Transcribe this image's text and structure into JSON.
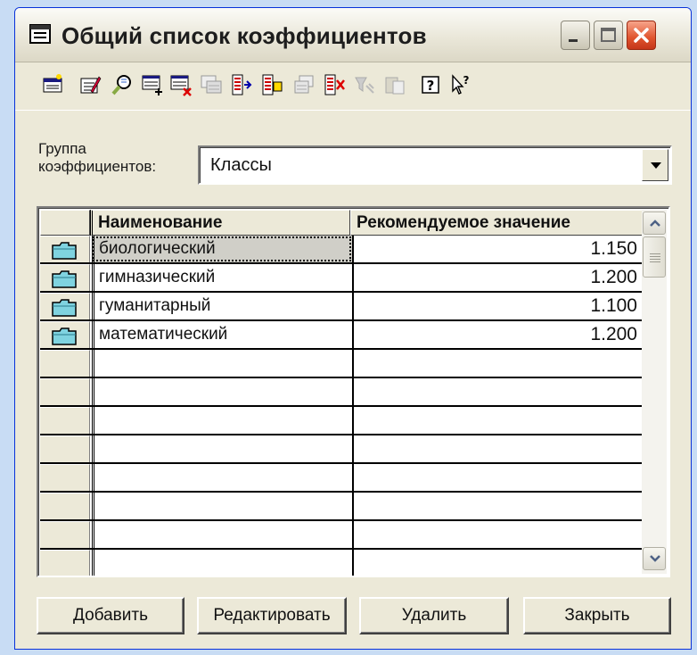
{
  "window": {
    "title": "Общий список коэффициентов",
    "controls": {
      "minimize": "minimize",
      "maximize": "maximize",
      "close": "close"
    }
  },
  "toolbar": {
    "icons": [
      "add-record-icon",
      "edit-record-icon",
      "search-icon",
      "insert-row-icon",
      "delete-row-icon",
      "copy-record-icon",
      "move-right-icon",
      "export-icon",
      "duplicate-icon",
      "remove-arrow-icon",
      "filter-icon",
      "paste-icon",
      "help-icon",
      "context-help-icon"
    ]
  },
  "group": {
    "label": "Группа\nкоэффициентов:",
    "selected": "Классы"
  },
  "table": {
    "columns": [
      "Наименование",
      "Рекомендуемое значение"
    ],
    "rows": [
      {
        "name": "биологический",
        "value": "1.150"
      },
      {
        "name": "гимназический",
        "value": "1.200"
      },
      {
        "name": "гуманитарный",
        "value": "1.100"
      },
      {
        "name": "математический",
        "value": "1.200"
      }
    ]
  },
  "buttons": {
    "add": "Добавить",
    "edit": "Редактировать",
    "delete": "Удалить",
    "close": "Закрыть"
  },
  "colors": {
    "window_bg": "#ece9d8",
    "close_button": "#e0542e",
    "folder_icon": "#7fd3e0"
  }
}
